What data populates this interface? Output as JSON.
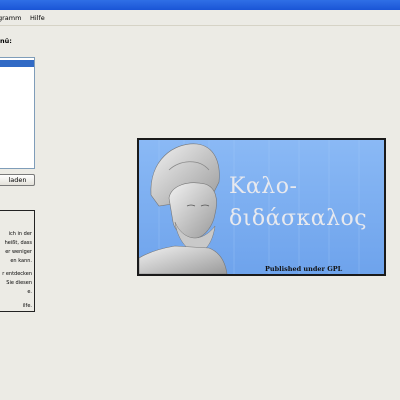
{
  "window": {
    "title": ""
  },
  "menubar": {
    "items": [
      "gramm",
      "Hilfe"
    ]
  },
  "sidebar": {
    "menu_label": "nü:",
    "load_button": "laden",
    "info_lines": [
      "ich in der",
      "heißt, dass",
      "er weniger",
      "en kann.",
      "r entdecken",
      "Sie diesen",
      "e.",
      "ilfe."
    ]
  },
  "splash": {
    "title_line1": "Καλο-",
    "title_line2": "διδάσκαλος",
    "license": "Published under GPL",
    "background": "#7fb0f2"
  }
}
